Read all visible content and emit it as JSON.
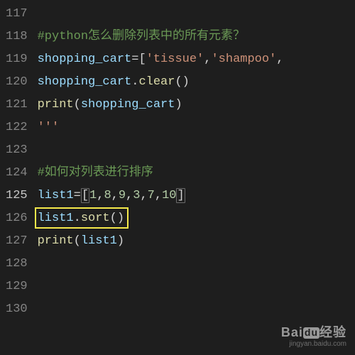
{
  "editor": {
    "active_line": 125,
    "lines": [
      {
        "num": 117,
        "tokens": []
      },
      {
        "num": 118,
        "tokens": [
          [
            "comment",
            "#python怎么删除列表中的所有元素？"
          ]
        ]
      },
      {
        "num": 119,
        "tokens": [
          [
            "ident",
            "shopping_cart"
          ],
          [
            "op",
            "="
          ],
          [
            "punc",
            "["
          ],
          [
            "str",
            "'tissue'"
          ],
          [
            "punc",
            ","
          ],
          [
            "str",
            "'shampoo'"
          ],
          [
            "punc",
            ","
          ]
        ]
      },
      {
        "num": 120,
        "tokens": [
          [
            "ident",
            "shopping_cart"
          ],
          [
            "punc",
            "."
          ],
          [
            "func",
            "clear"
          ],
          [
            "punc",
            "()"
          ]
        ]
      },
      {
        "num": 121,
        "tokens": [
          [
            "builtin",
            "print"
          ],
          [
            "punc",
            "("
          ],
          [
            "ident",
            "shopping_cart"
          ],
          [
            "punc",
            ")"
          ]
        ]
      },
      {
        "num": 122,
        "tokens": [
          [
            "str",
            "'''"
          ]
        ]
      },
      {
        "num": 123,
        "tokens": []
      },
      {
        "num": 124,
        "tokens": [
          [
            "comment",
            "#如何对列表进行排序"
          ]
        ]
      },
      {
        "num": 125,
        "tokens": [
          [
            "ident",
            "list1"
          ],
          [
            "op",
            "="
          ],
          [
            "punc-match",
            "["
          ],
          [
            "num",
            "1"
          ],
          [
            "punc",
            ","
          ],
          [
            "num",
            "8"
          ],
          [
            "punc",
            ","
          ],
          [
            "num",
            "9"
          ],
          [
            "punc",
            ","
          ],
          [
            "num",
            "3"
          ],
          [
            "punc",
            ","
          ],
          [
            "num",
            "7"
          ],
          [
            "punc",
            ","
          ],
          [
            "num",
            "10"
          ],
          [
            "punc-match",
            "]"
          ]
        ]
      },
      {
        "num": 126,
        "tokens": [
          [
            "ident",
            "list1"
          ],
          [
            "punc",
            "."
          ],
          [
            "func",
            "sort"
          ],
          [
            "punc",
            "()"
          ]
        ]
      },
      {
        "num": 127,
        "tokens": [
          [
            "builtin",
            "print"
          ],
          [
            "punc",
            "("
          ],
          [
            "ident",
            "list1"
          ],
          [
            "punc",
            ")"
          ]
        ]
      },
      {
        "num": 128,
        "tokens": []
      },
      {
        "num": 129,
        "tokens": []
      },
      {
        "num": 130,
        "tokens": []
      }
    ],
    "highlight": {
      "line_index": 9,
      "left": 0,
      "width": 132,
      "height": 30
    }
  },
  "watermark": {
    "brand_prefix": "Bai",
    "brand_box": "du",
    "brand_suffix": "经验",
    "url": "jingyan.baidu.com"
  }
}
